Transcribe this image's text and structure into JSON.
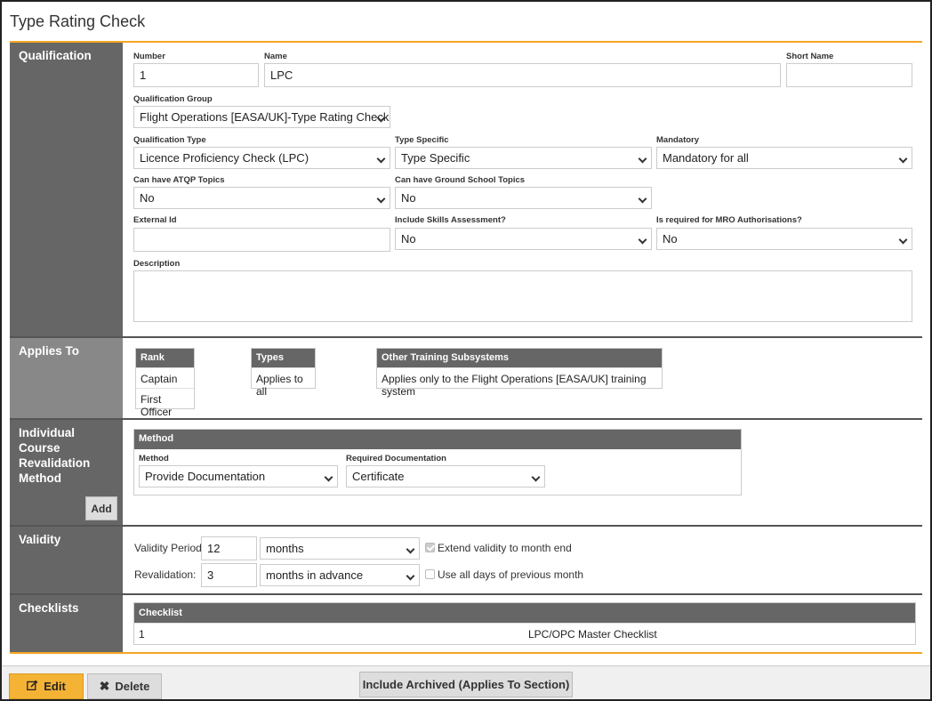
{
  "page": {
    "title": "Type Rating Check"
  },
  "qualification": {
    "section_label": "Qualification",
    "number": {
      "label": "Number",
      "value": "1"
    },
    "name": {
      "label": "Name",
      "value": "LPC"
    },
    "short_name": {
      "label": "Short Name",
      "value": ""
    },
    "group": {
      "label": "Qualification Group",
      "value": "Flight Operations [EASA/UK]-Type Rating Check"
    },
    "type": {
      "label": "Qualification Type",
      "value": "Licence Proficiency Check (LPC)"
    },
    "type_specific": {
      "label": "Type Specific",
      "value": "Type Specific"
    },
    "mandatory": {
      "label": "Mandatory",
      "value": "Mandatory for all"
    },
    "atqp": {
      "label": "Can have ATQP Topics",
      "value": "No"
    },
    "ground_school": {
      "label": "Can have Ground School Topics",
      "value": "No"
    },
    "external_id": {
      "label": "External Id",
      "value": ""
    },
    "skills_assessment": {
      "label": "Include Skills Assessment?",
      "value": "No"
    },
    "mro": {
      "label": "Is required for MRO Authorisations?",
      "value": "No"
    },
    "description": {
      "label": "Description",
      "value": ""
    }
  },
  "applies_to": {
    "section_label": "Applies To",
    "rank": {
      "header": "Rank",
      "rows": [
        "Captain",
        "First Officer"
      ]
    },
    "types": {
      "header": "Types",
      "rows": [
        "Applies to all"
      ]
    },
    "other": {
      "header": "Other Training Subsystems",
      "rows": [
        "Applies only to the Flight Operations [EASA/UK] training system"
      ]
    }
  },
  "revalidation": {
    "section_label": "Individual Course Revalidation Method",
    "table_header": "Method",
    "method_label": "Method",
    "method_value": "Provide Documentation",
    "docs_label": "Required Documentation",
    "docs_value": "Certificate",
    "add_button": "Add"
  },
  "validity": {
    "section_label": "Validity",
    "period_label": "Validity Period:",
    "period_value": "12",
    "period_unit": "months",
    "extend_label": "Extend validity to month end",
    "extend_checked": true,
    "reval_label": "Revalidation:",
    "reval_value": "3",
    "reval_unit": "months in advance",
    "use_all_label": "Use all days of previous month",
    "use_all_checked": false
  },
  "checklists": {
    "section_label": "Checklists",
    "header": "Checklist",
    "rows": [
      {
        "id": "1",
        "name": "LPC/OPC Master Checklist"
      }
    ]
  },
  "footer": {
    "edit": "Edit",
    "delete": "Delete",
    "include_archived": "Include Archived (Applies To Section)"
  },
  "colors": {
    "accent": "#f5a623",
    "section_label_bg": "#666666",
    "button_primary": "#f5b335"
  },
  "icons": {
    "edit": "edit-icon",
    "delete": "close-icon",
    "select": "chevron-down-icon"
  }
}
